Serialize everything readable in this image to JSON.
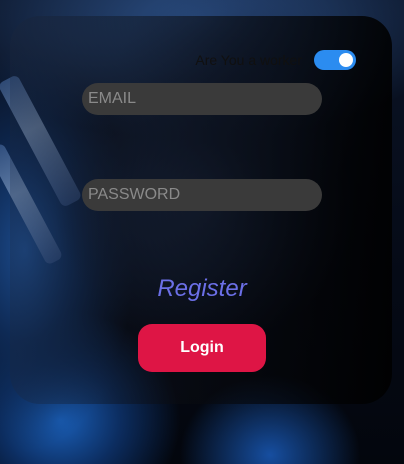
{
  "worker_toggle": {
    "label": "Are You a worker",
    "checked": true
  },
  "form": {
    "email_placeholder": "EMAIL",
    "password_placeholder": "PASSWORD",
    "register_link": "Register",
    "login_button": "Login"
  },
  "colors": {
    "toggle_on": "#2b8cf0",
    "register_link": "#6b6fe6",
    "login_button": "#de1545"
  }
}
